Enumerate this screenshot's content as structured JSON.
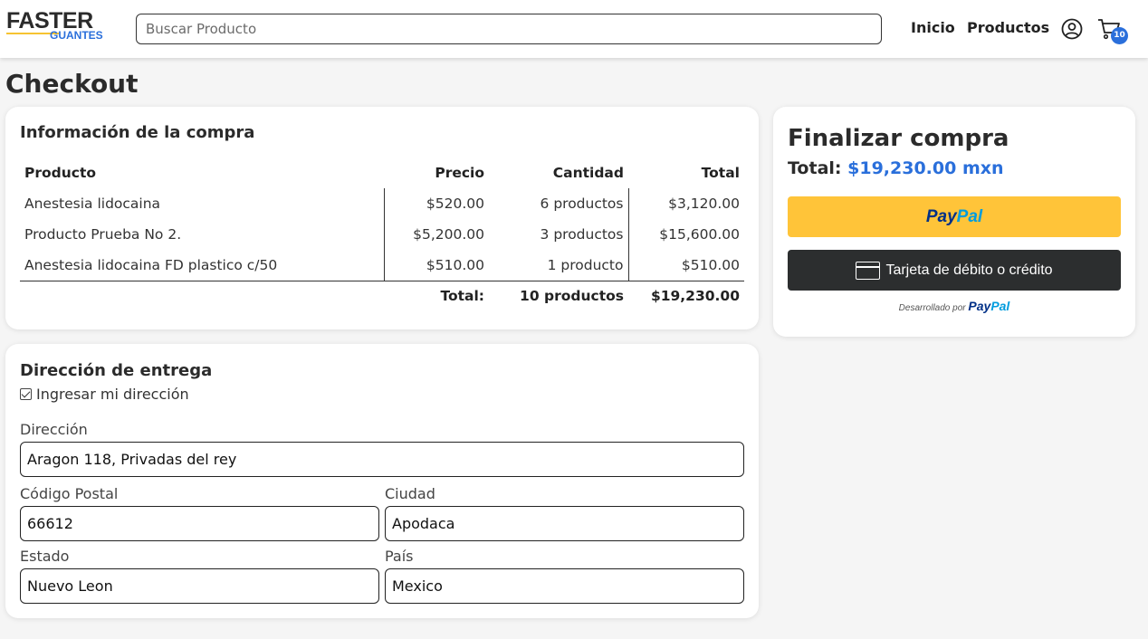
{
  "header": {
    "logo_top": "FASTER",
    "logo_sub": "GUANTES",
    "search_placeholder": "Buscar Producto",
    "nav": {
      "home": "Inicio",
      "products": "Productos"
    },
    "cart_count": "10"
  },
  "page_title": "Checkout",
  "order": {
    "title": "Información de la compra",
    "columns": {
      "product": "Producto",
      "price": "Precio",
      "qty": "Cantidad",
      "total": "Total"
    },
    "rows": [
      {
        "product": "Anestesia lidocaina",
        "price": "$520.00",
        "qty": "6 productos",
        "total": "$3,120.00"
      },
      {
        "product": "Producto Prueba No 2.",
        "price": "$5,200.00",
        "qty": "3 productos",
        "total": "$15,600.00"
      },
      {
        "product": "Anestesia lidocaina FD plastico c/50",
        "price": "$510.00",
        "qty": "1 producto",
        "total": "$510.00"
      }
    ],
    "footer": {
      "label": "Total:",
      "qty": "10 productos",
      "total": "$19,230.00"
    }
  },
  "address": {
    "title": "Dirección de entrega",
    "checkbox_label": "Ingresar mi dirección",
    "checkbox_checked": true,
    "fields": {
      "direccion": {
        "label": "Dirección",
        "value": "Aragon 118, Privadas del rey"
      },
      "cp": {
        "label": "Código Postal",
        "value": "66612"
      },
      "ciudad": {
        "label": "Ciudad",
        "value": "Apodaca"
      },
      "estado": {
        "label": "Estado",
        "value": "Nuevo Leon"
      },
      "pais": {
        "label": "País",
        "value": "Mexico"
      }
    }
  },
  "payment": {
    "title": "Finalizar compra",
    "total_label": "Total:",
    "total_amount": "$19,230.00 mxn",
    "paypal_pay": "Pay",
    "paypal_pal": "Pal",
    "card_button": "Tarjeta de débito o crédito",
    "powered_by": "Desarrollado por"
  },
  "colors": {
    "accent_blue": "#2a6fdb",
    "paypal_yellow": "#ffc439",
    "card_button_dark": "#2c2e2f",
    "logo_underline": "#f6c331"
  }
}
